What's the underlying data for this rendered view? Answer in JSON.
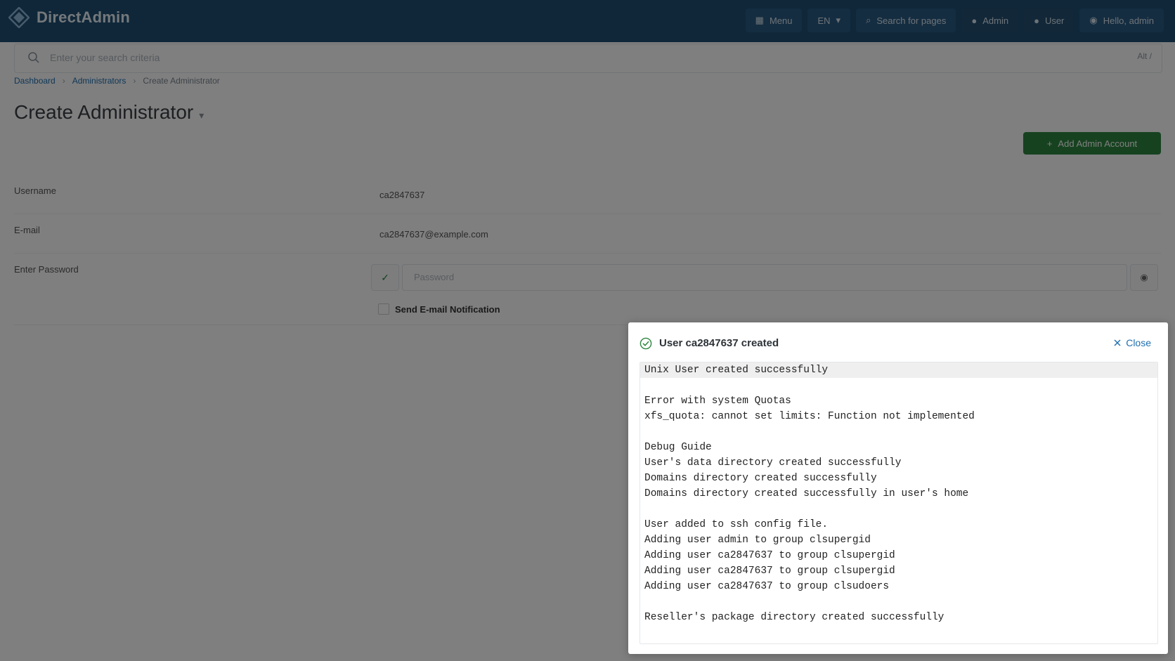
{
  "app": {
    "brand_name": "DirectAdmin",
    "nav": {
      "menu_label": "Menu",
      "language_label": "EN",
      "search_pages_label": "Search for pages",
      "admin_label": "Admin",
      "user_label": "User",
      "account_label": "Hello, admin"
    },
    "search": {
      "placeholder": "Enter your search criteria",
      "shortcut": "Alt /"
    }
  },
  "breadcrumb": [
    "Dashboard",
    "Administrators",
    "Create Administrator"
  ],
  "page": {
    "title": "Create Administrator",
    "add_button_label": "Add Admin Account"
  },
  "form": {
    "username_label": "Username",
    "username_value": "ca2847637",
    "email_label": "E-mail",
    "email_value": "ca2847637@example.com",
    "password_label": "Enter Password",
    "password_placeholder": "Password",
    "notify_label": "Send E-mail Notification"
  },
  "dialog": {
    "title": "User ca2847637 created",
    "close_label": "Close",
    "log_lines": [
      "Unix User created successfully",
      "",
      "Error with system Quotas",
      "xfs_quota: cannot set limits: Function not implemented",
      "",
      "Debug Guide",
      "User's data directory created successfully",
      "Domains directory created successfully",
      "Domains directory created successfully in user's home",
      "",
      "User added to ssh config file.",
      "Adding user admin to group clsupergid",
      "Adding user ca2847637 to group clsupergid",
      "Adding user ca2847637 to group clsupergid",
      "Adding user ca2847637 to group clsudoers",
      "",
      "Reseller's package directory created successfully"
    ]
  },
  "colors": {
    "accent": "#1f6fb0",
    "success": "#2e8540",
    "header_bg": "#1f4e73"
  }
}
